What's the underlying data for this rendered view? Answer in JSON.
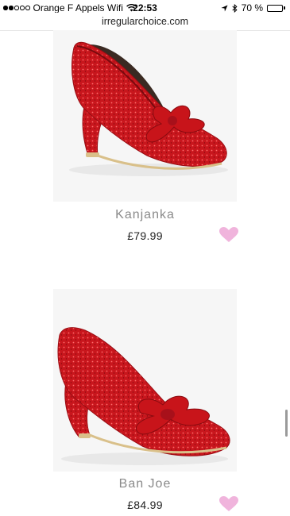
{
  "status_bar": {
    "carrier": "Orange F Appels Wifi",
    "time": "22:53",
    "battery_text": "70 %",
    "battery_level": 0.7,
    "signal_bars_filled": 2,
    "signal_bars_total": 5
  },
  "browser": {
    "url": "irregularchoice.com"
  },
  "products": [
    {
      "name": "Kanjanka",
      "price": "£79.99"
    },
    {
      "name": "Ban Joe",
      "price": "£84.99"
    }
  ],
  "colors": {
    "heart": "#f0b4dc",
    "shoe_red": "#c8161d",
    "name_gray": "#8a8a8a"
  }
}
